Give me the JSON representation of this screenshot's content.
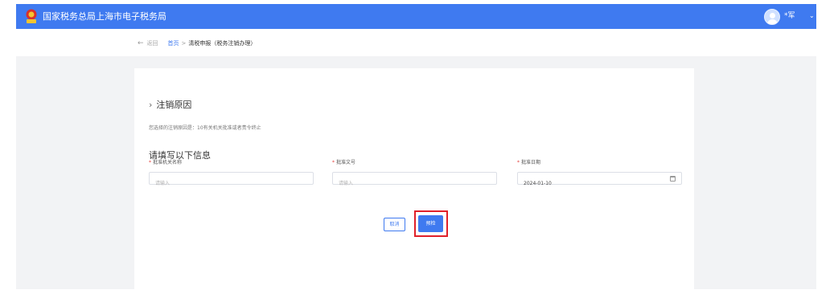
{
  "header": {
    "title": "国家税务总局上海市电子税务局",
    "user_name": "*军",
    "user_caret": "⌄",
    "logo_icon": "tax-emblem-icon",
    "avatar_icon": "user-avatar-icon",
    "brand_color": "#3f7af0"
  },
  "breadcrumb": {
    "back_icon": "←",
    "back_label": "返回",
    "home": "首页",
    "separator": ">",
    "current": "清税申报（税务注销办理）"
  },
  "section": {
    "chevron": "›",
    "title": "注销原因",
    "reason_text": "您选择的注销原因是：10有关机关批准或者责令终止"
  },
  "info": {
    "title": "请填写以下信息"
  },
  "fields": [
    {
      "required_mark": "*",
      "label": "批准机关名称",
      "value": "",
      "placeholder": "请输入"
    },
    {
      "required_mark": "*",
      "label": "批准文号",
      "value": "",
      "placeholder": "请输入"
    },
    {
      "required_mark": "*",
      "label": "批准日期",
      "value": "2024-01-10",
      "placeholder": ""
    }
  ],
  "actions": {
    "cancel": "取消",
    "check": "预检",
    "highlight_color": "#e0202a"
  }
}
